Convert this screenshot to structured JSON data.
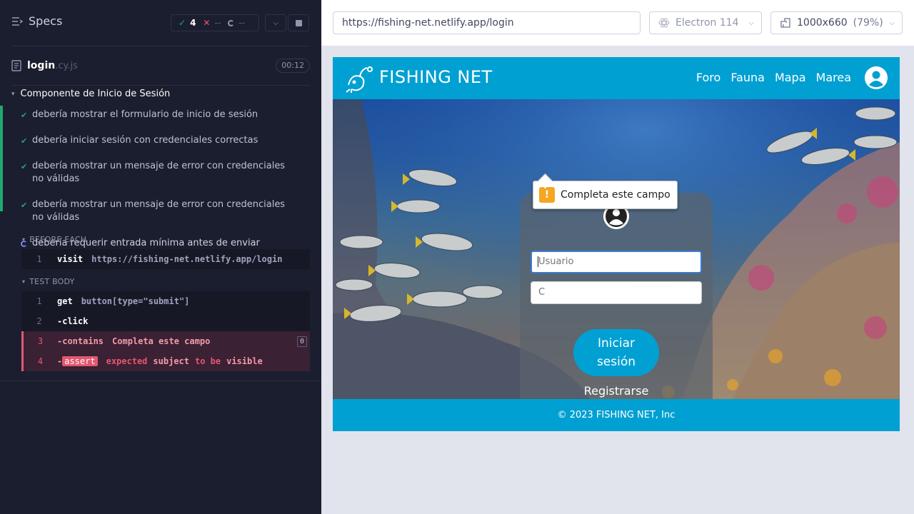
{
  "runner": {
    "header": {
      "title": "Specs",
      "passed": "4",
      "failed": "--",
      "pending": "--"
    },
    "spec": {
      "name": "login",
      "ext": ".cy.js",
      "duration": "00:12"
    },
    "suite": "Componente de Inicio de Sesión",
    "tests": [
      {
        "title": "debería mostrar el formulario de inicio de sesión",
        "state": "passed"
      },
      {
        "title": "debería iniciar sesión con credenciales correctas",
        "state": "passed"
      },
      {
        "title": "debería mostrar un mensaje de error con credenciales no válidas",
        "state": "passed"
      },
      {
        "title": "debería mostrar un mensaje de error con credenciales no válidas",
        "state": "passed"
      },
      {
        "title": "debería requerir entrada mínima antes de enviar",
        "state": "running"
      }
    ],
    "before_each": {
      "label": "BEFORE EACH",
      "commands": [
        {
          "num": "1",
          "name": "visit",
          "message": "https://fishing-net.netlify.app/login"
        }
      ]
    },
    "test_body": {
      "label": "TEST BODY",
      "commands": [
        {
          "num": "1",
          "name": "get",
          "message": "button[type=\"submit\"]"
        },
        {
          "num": "2",
          "name": "-click",
          "message": ""
        },
        {
          "num": "3",
          "name": "-contains",
          "message": "Completa este campo",
          "count": "0"
        },
        {
          "num": "4",
          "prefix": "-",
          "name": "assert",
          "message_parts": [
            "expected",
            "subject",
            "to be",
            "visible"
          ]
        }
      ]
    }
  },
  "aut": {
    "url": "https://fishing-net.netlify.app/login",
    "browser": "Electron 114",
    "viewport": "1000x660",
    "scale": "(79%)",
    "app": {
      "brand": "FISHING NET",
      "nav": [
        "Foro",
        "Fauna",
        "Mapa",
        "Marea"
      ],
      "login": {
        "username_placeholder": "Usuario",
        "password_placeholder": "C",
        "submit_label_line1": "Iniciar",
        "submit_label_line2": "sesión",
        "register": "Registrarse"
      },
      "validation_tooltip": "Completa este campo",
      "footer": "© 2023 FISHING NET, Inc"
    }
  },
  "colors": {
    "accent": "#00a0d2",
    "pass": "#1fa971",
    "fail": "#e45770",
    "panel_bg": "#1b1e2e"
  }
}
